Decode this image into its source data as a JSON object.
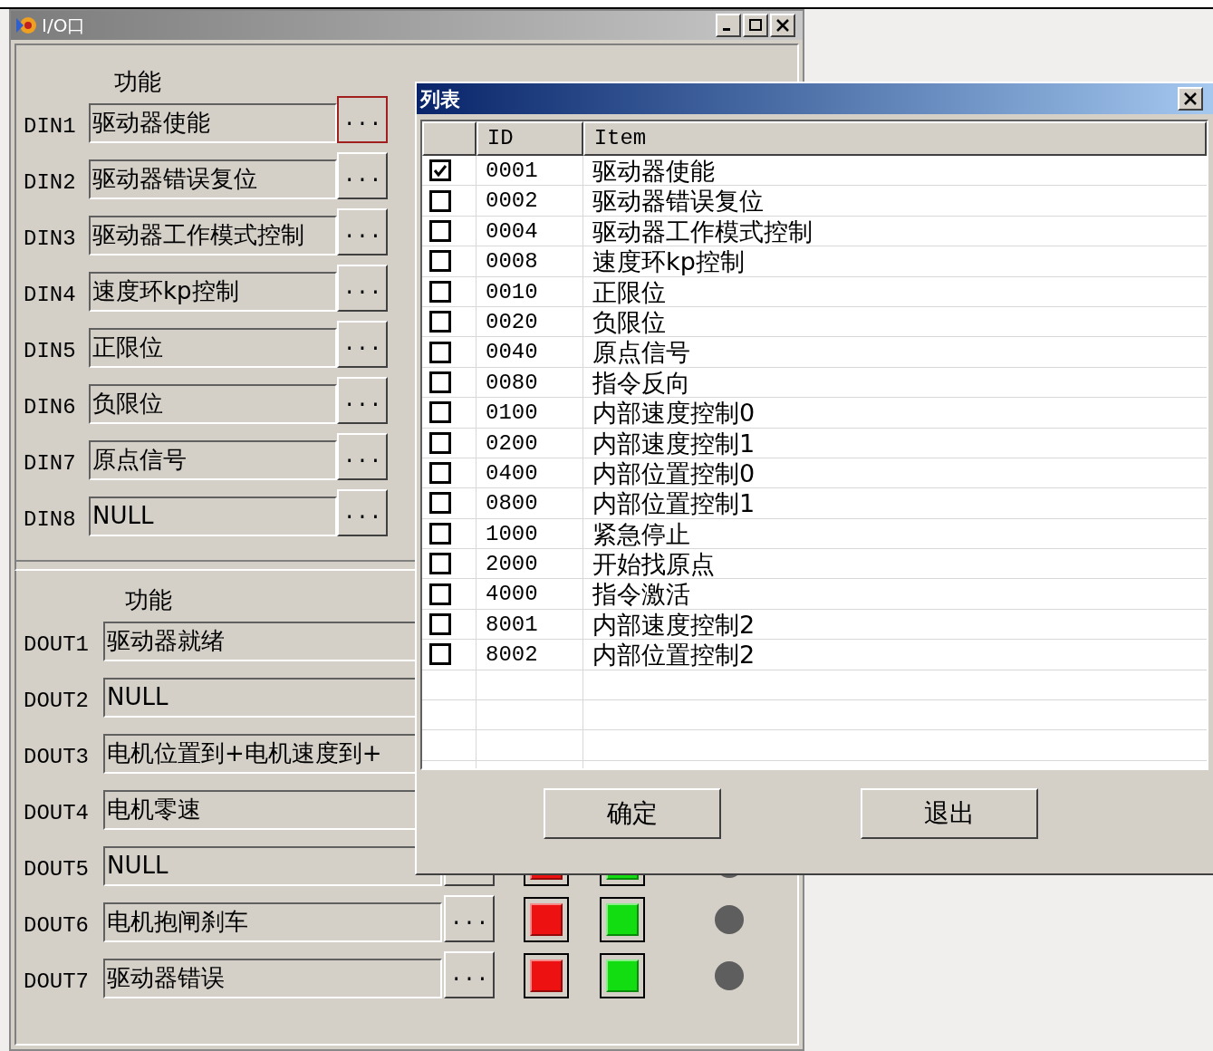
{
  "window": {
    "title": "I/O口"
  },
  "din": {
    "heading": "功能",
    "rows": [
      {
        "label": "DIN1",
        "value": "驱动器使能",
        "button": "...",
        "focused": true
      },
      {
        "label": "DIN2",
        "value": "驱动器错误复位",
        "button": "...",
        "focused": false
      },
      {
        "label": "DIN3",
        "value": "驱动器工作模式控制",
        "button": "...",
        "focused": false
      },
      {
        "label": "DIN4",
        "value": "速度环kp控制",
        "button": "...",
        "focused": false
      },
      {
        "label": "DIN5",
        "value": "正限位",
        "button": "...",
        "focused": false
      },
      {
        "label": "DIN6",
        "value": "负限位",
        "button": "...",
        "focused": false
      },
      {
        "label": "DIN7",
        "value": "原点信号",
        "button": "...",
        "focused": false
      },
      {
        "label": "DIN8",
        "value": "NULL",
        "button": "...",
        "focused": false
      }
    ]
  },
  "dout": {
    "heading": "功能",
    "rows": [
      {
        "label": "DOUT1",
        "value": "驱动器就绪"
      },
      {
        "label": "DOUT2",
        "value": "NULL"
      },
      {
        "label": "DOUT3",
        "value": "电机位置到+电机速度到+"
      },
      {
        "label": "DOUT4",
        "value": "电机零速"
      },
      {
        "label": "DOUT5",
        "value": "NULL",
        "button": "",
        "lamps": [
          {
            "kind": "square",
            "color": "#ee1111"
          },
          {
            "kind": "square",
            "color": "#11dd11"
          },
          {
            "kind": "dot",
            "color": "#5e5e5e"
          }
        ]
      },
      {
        "label": "DOUT6",
        "value": "电机抱闸刹车",
        "button": "...",
        "lamps": [
          {
            "kind": "square",
            "color": "#ee1111"
          },
          {
            "kind": "square",
            "color": "#11dd11"
          },
          {
            "kind": "dot",
            "color": "#5e5e5e"
          }
        ]
      },
      {
        "label": "DOUT7",
        "value": "驱动器错误",
        "button": "...",
        "lamps": [
          {
            "kind": "square",
            "color": "#ee1111"
          },
          {
            "kind": "square",
            "color": "#11dd11"
          },
          {
            "kind": "dot",
            "color": "#5e5e5e"
          }
        ]
      }
    ]
  },
  "dialog": {
    "title": "列表",
    "columns": [
      "ID",
      "Item"
    ],
    "rows": [
      {
        "checked": true,
        "id": "0001",
        "item": "驱动器使能"
      },
      {
        "checked": false,
        "id": "0002",
        "item": "驱动器错误复位"
      },
      {
        "checked": false,
        "id": "0004",
        "item": "驱动器工作模式控制"
      },
      {
        "checked": false,
        "id": "0008",
        "item": "速度环kp控制"
      },
      {
        "checked": false,
        "id": "0010",
        "item": "正限位"
      },
      {
        "checked": false,
        "id": "0020",
        "item": "负限位"
      },
      {
        "checked": false,
        "id": "0040",
        "item": "原点信号"
      },
      {
        "checked": false,
        "id": "0080",
        "item": "指令反向"
      },
      {
        "checked": false,
        "id": "0100",
        "item": "内部速度控制0"
      },
      {
        "checked": false,
        "id": "0200",
        "item": "内部速度控制1"
      },
      {
        "checked": false,
        "id": "0400",
        "item": "内部位置控制0"
      },
      {
        "checked": false,
        "id": "0800",
        "item": "内部位置控制1"
      },
      {
        "checked": false,
        "id": "1000",
        "item": "紧急停止"
      },
      {
        "checked": false,
        "id": "2000",
        "item": "开始找原点"
      },
      {
        "checked": false,
        "id": "4000",
        "item": "指令激活"
      },
      {
        "checked": false,
        "id": "8001",
        "item": "内部速度控制2"
      },
      {
        "checked": false,
        "id": "8002",
        "item": "内部位置控制2"
      }
    ],
    "buttons": [
      "确定",
      "退出"
    ]
  }
}
